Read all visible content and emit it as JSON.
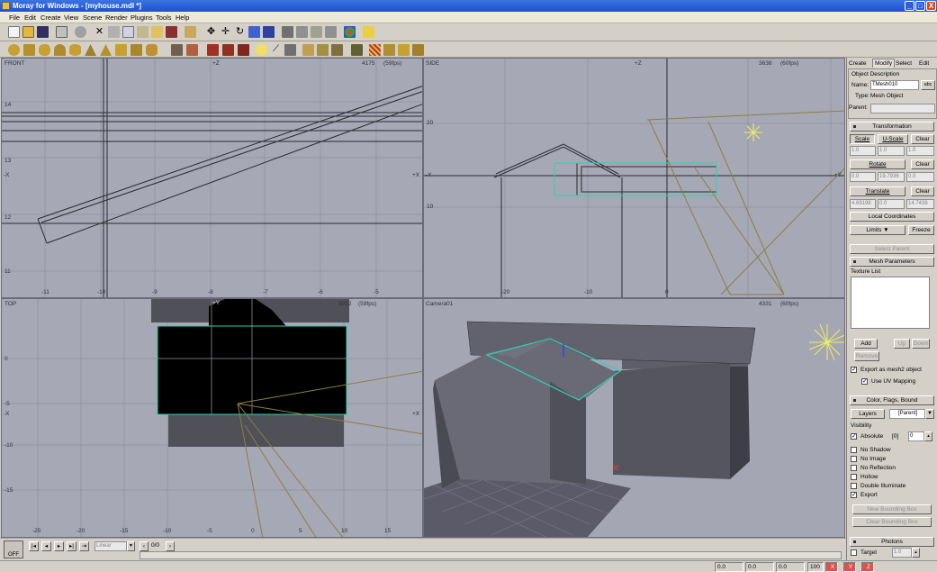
{
  "window": {
    "title": "Moray for Windows - [myhouse.mdl *]",
    "min": "_",
    "max": "□",
    "close": "X"
  },
  "menu": [
    "File",
    "Edit",
    "Create",
    "View",
    "Scene",
    "Render",
    "Plugins",
    "Tools",
    "Help"
  ],
  "viewports": {
    "front": {
      "name": "FRONT",
      "info": "4175",
      "fps": "(59fps)",
      "axis_top": "+Z",
      "axis_left": "-X",
      "axis_right": "+X",
      "yticks": [
        "14",
        "13",
        "12",
        "11"
      ],
      "xticks": [
        "-11",
        "-10",
        "-9",
        "-8",
        "-7",
        "-6",
        "-5"
      ]
    },
    "side": {
      "name": "SIDE",
      "info": "3638",
      "fps": "(60fps)",
      "axis_top": "+Z",
      "axis_left": "-Y",
      "axis_right": "+Y",
      "yticks": [
        "20",
        "10"
      ],
      "xticks": [
        "-20",
        "-10",
        "0"
      ]
    },
    "top": {
      "name": "TOP",
      "info": "3052",
      "fps": "(59fps)",
      "axis_top": "+Y",
      "axis_left": "-X",
      "axis_right": "+X",
      "yticks": [
        "0",
        "-5",
        "-10",
        "-15"
      ],
      "xticks": [
        "-25",
        "-20",
        "-15",
        "-10",
        "-5",
        "0",
        "5",
        "10",
        "15"
      ]
    },
    "camera": {
      "name": "Camera01",
      "info": "4331",
      "fps": "(60fps)"
    }
  },
  "panel": {
    "tabs": [
      "Create",
      "Modify",
      "Select",
      "Edit"
    ],
    "object_description": "Object Description",
    "name_label": "Name:",
    "name_value": "TMesh010",
    "abc": "abc",
    "type_label": "Type:",
    "type_value": "Mesh Object",
    "parent_label": "Parent:",
    "transformation": "Transformation",
    "scale": "Scale",
    "uscale": "U-Scale",
    "clear": "Clear",
    "scale_vals": [
      "1.0",
      "1.0",
      "1.0"
    ],
    "rotate": "Rotate",
    "rotate_vals": [
      "0.0",
      "19.7936",
      "0.0"
    ],
    "translate": "Translate",
    "translate_vals": [
      "4.69198",
      "0.0",
      "14.7438"
    ],
    "local_coords": "Local Coordinates",
    "limits": "Limits",
    "freeze": "Freeze",
    "select_parent": "Select Parent",
    "mesh_params": "Mesh Parameters",
    "texture_list": "Texture List",
    "add": "Add",
    "up": "Up",
    "down": "Down",
    "remove": "Remove",
    "export_mesh2": "Export as mesh2 object",
    "use_uv": "Use UV Mapping",
    "color_flags": "Color, Flags, Bound",
    "layers": "Layers",
    "layer_sel": "[Parent]",
    "visibility": "Visibility",
    "absolute": "Absolute",
    "abs_val": "[0]",
    "abs_spin": "0",
    "flags": [
      "No Shadow",
      "No Image",
      "No Reflection",
      "Hollow",
      "Double Illuminate",
      "Export"
    ],
    "new_bbox": "New Bounding Box",
    "clear_bbox": "Clear Bounding Box",
    "photons": "Photons",
    "target": "Target",
    "target_val": "1.0"
  },
  "bottom": {
    "off": "OFF",
    "interp": "Linear",
    "frame": "0/0"
  },
  "status": {
    "x": "0.0",
    "y": "0.0",
    "z": "0.0",
    "zoom": "100",
    "bx": "X",
    "by": "Y",
    "bz": "Z"
  },
  "colors": {
    "selected": "#30d0b0",
    "wire": "#2a2a30",
    "light": "#f0f060",
    "camera_line": "#8a8040"
  }
}
